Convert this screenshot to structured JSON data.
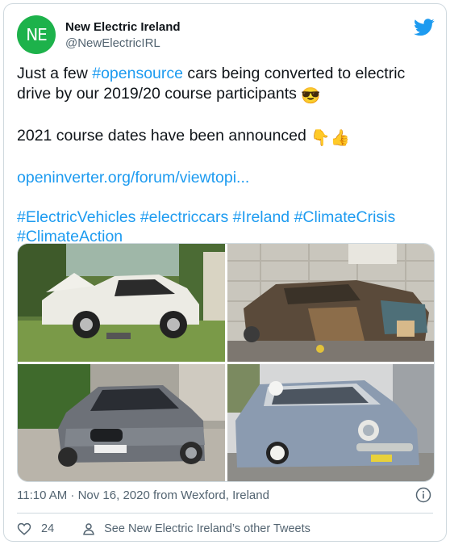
{
  "author": {
    "name": "New Electric Ireland",
    "handle": "@NewElectricIRL",
    "avatar_text": "NE",
    "avatar_color": "#1db24b"
  },
  "tweet": {
    "line1_pre": "Just a few ",
    "hashtag_opensource": "#opensource",
    "line1_post": " cars being converted to electric drive by our 2019/20 course participants ",
    "emoji_cool": "😎",
    "line2": "2021 course dates have been announced ",
    "emoji_point": "👇👍",
    "url": "openinverter.org/forum/viewtopi...",
    "hashtags_line1": "#ElectricVehicles #electriccars #Ireland #ClimateCrisis",
    "hashtags_line2": "#ClimateAction"
  },
  "meta": {
    "timestamp": "11:10 AM · Nov 16, 2020 from Wexford, Ireland"
  },
  "footer": {
    "likes": "24",
    "see_more": "See New Electric Ireland’s other Tweets"
  },
  "colors": {
    "link": "#1d9bf0",
    "twitter_blue": "#1d9bf0",
    "muted": "#536471"
  },
  "icons": {
    "logo": "twitter-bird-icon",
    "info": "info-icon",
    "like": "heart-icon",
    "profile": "person-icon"
  }
}
